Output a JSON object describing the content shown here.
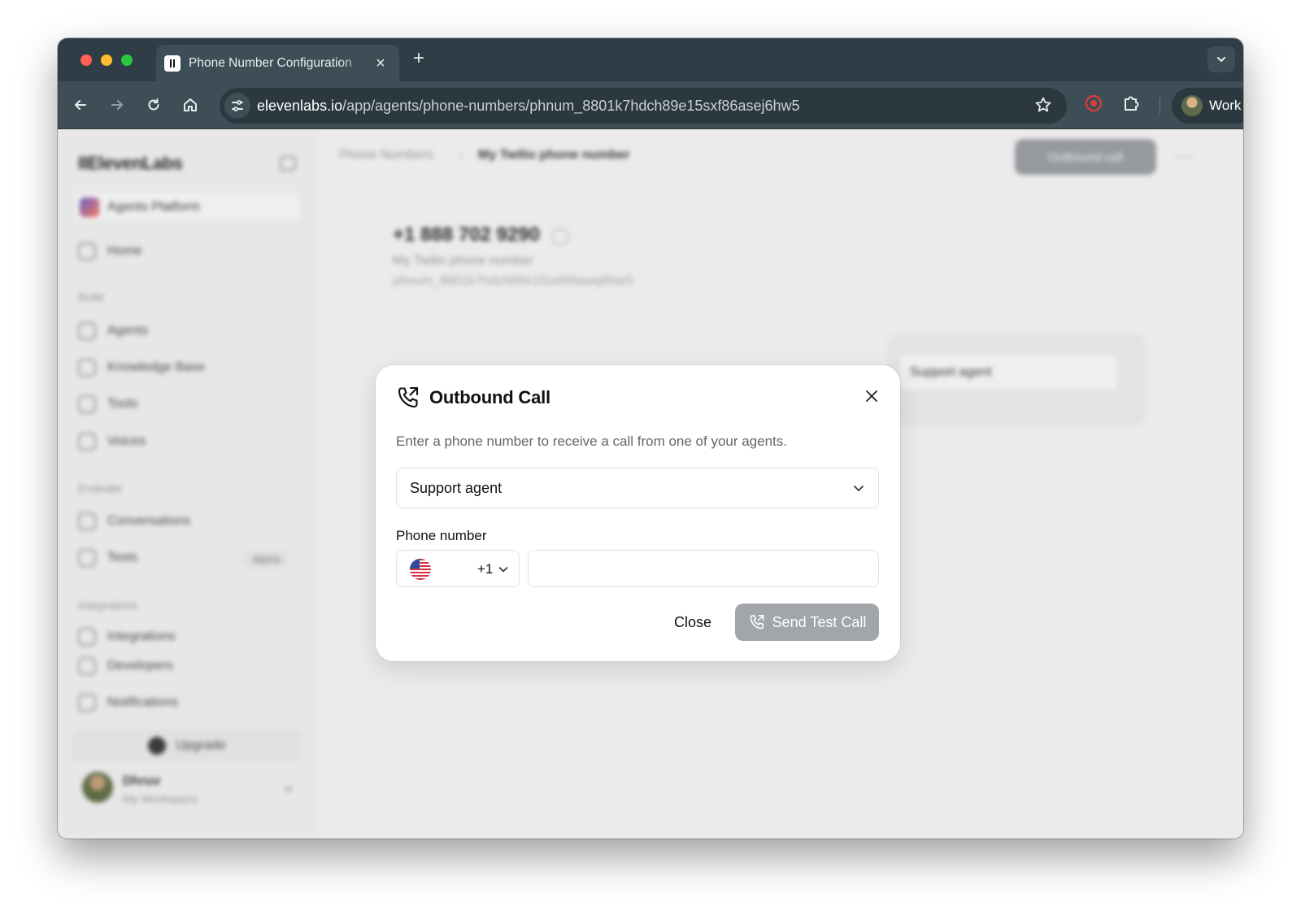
{
  "browser": {
    "tab_title": "Phone Number Configuration",
    "url_host": "elevenlabs.io",
    "url_path": "/app/agents/phone-numbers/phnum_8801k7hdch89e15sxf86asej6hw5",
    "profile_label": "Work"
  },
  "sidebar": {
    "logo": "IIElevenLabs",
    "workspace": "Agents Platform",
    "home": "Home",
    "section_build": "Build",
    "build_items": [
      "Agents",
      "Knowledge Base",
      "Tools",
      "Voices"
    ],
    "section_evaluate": "Evaluate",
    "evaluate_items": [
      "Conversations",
      "Tests"
    ],
    "tests_badge": "Alpha",
    "section_integrations": "Integrations",
    "integration_items": [
      "Integrations",
      "Developers",
      "Notifications"
    ],
    "upgrade": "Upgrade",
    "user_name": "Dhruv",
    "user_workspace": "My Workspace"
  },
  "page": {
    "breadcrumb_parent": "Phone Numbers",
    "breadcrumb_sep": "›",
    "breadcrumb_current": "My Twilio phone number",
    "outbound_call_button": "Outbound call",
    "more_button": "···",
    "phone_number": "+1 888 702 9290",
    "phone_label": "My Twilio phone number",
    "phone_id": "phnum_8801k7hdch89e15sxf86asej6hw5",
    "assigned_agent": "Support agent"
  },
  "modal": {
    "title": "Outbound Call",
    "description": "Enter a phone number to receive a call from one of your agents.",
    "agent_select": "Support agent",
    "phone_label": "Phone number",
    "country_code": "+1",
    "phone_value": "",
    "phone_placeholder": "",
    "close_label": "Close",
    "send_label": "Send Test Call",
    "send_disabled_color": "#a2a6ab"
  }
}
